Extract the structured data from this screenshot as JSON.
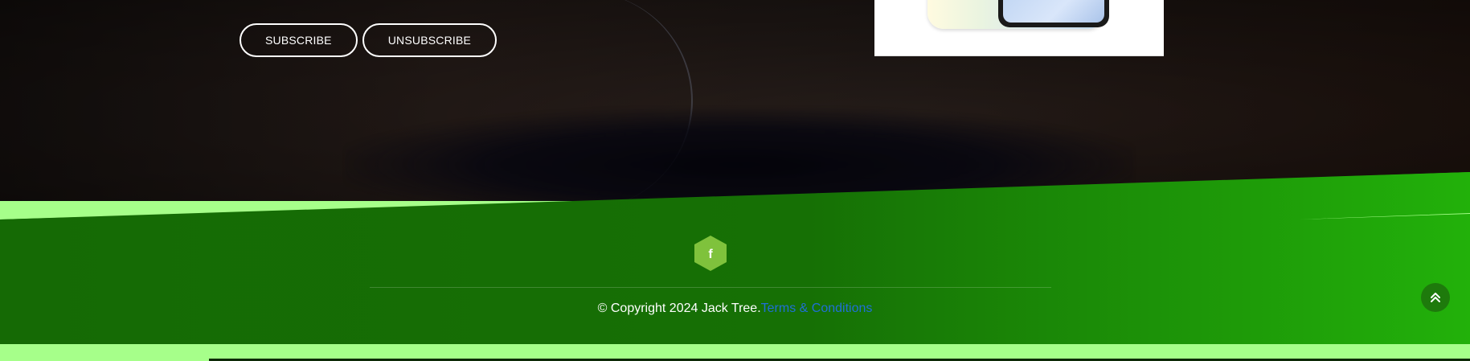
{
  "buttons": {
    "subscribe": "SUBSCRIBE",
    "unsubscribe": "UNSUBSCRIBE"
  },
  "footer": {
    "social_icon": "facebook-icon",
    "copyright": "© Copyright 2024 Jack Tree.",
    "terms_link": "Terms & Conditions",
    "scroll_top_icon": "double-chevron-up-icon"
  },
  "colors": {
    "hero_dark": "#231b18",
    "footer_green_dark": "#156a05",
    "footer_green_bright": "#22b10a",
    "accent_light_green": "#a6ff8a",
    "social_hex": "#7fc23c",
    "link_blue": "#1f6fd8"
  }
}
